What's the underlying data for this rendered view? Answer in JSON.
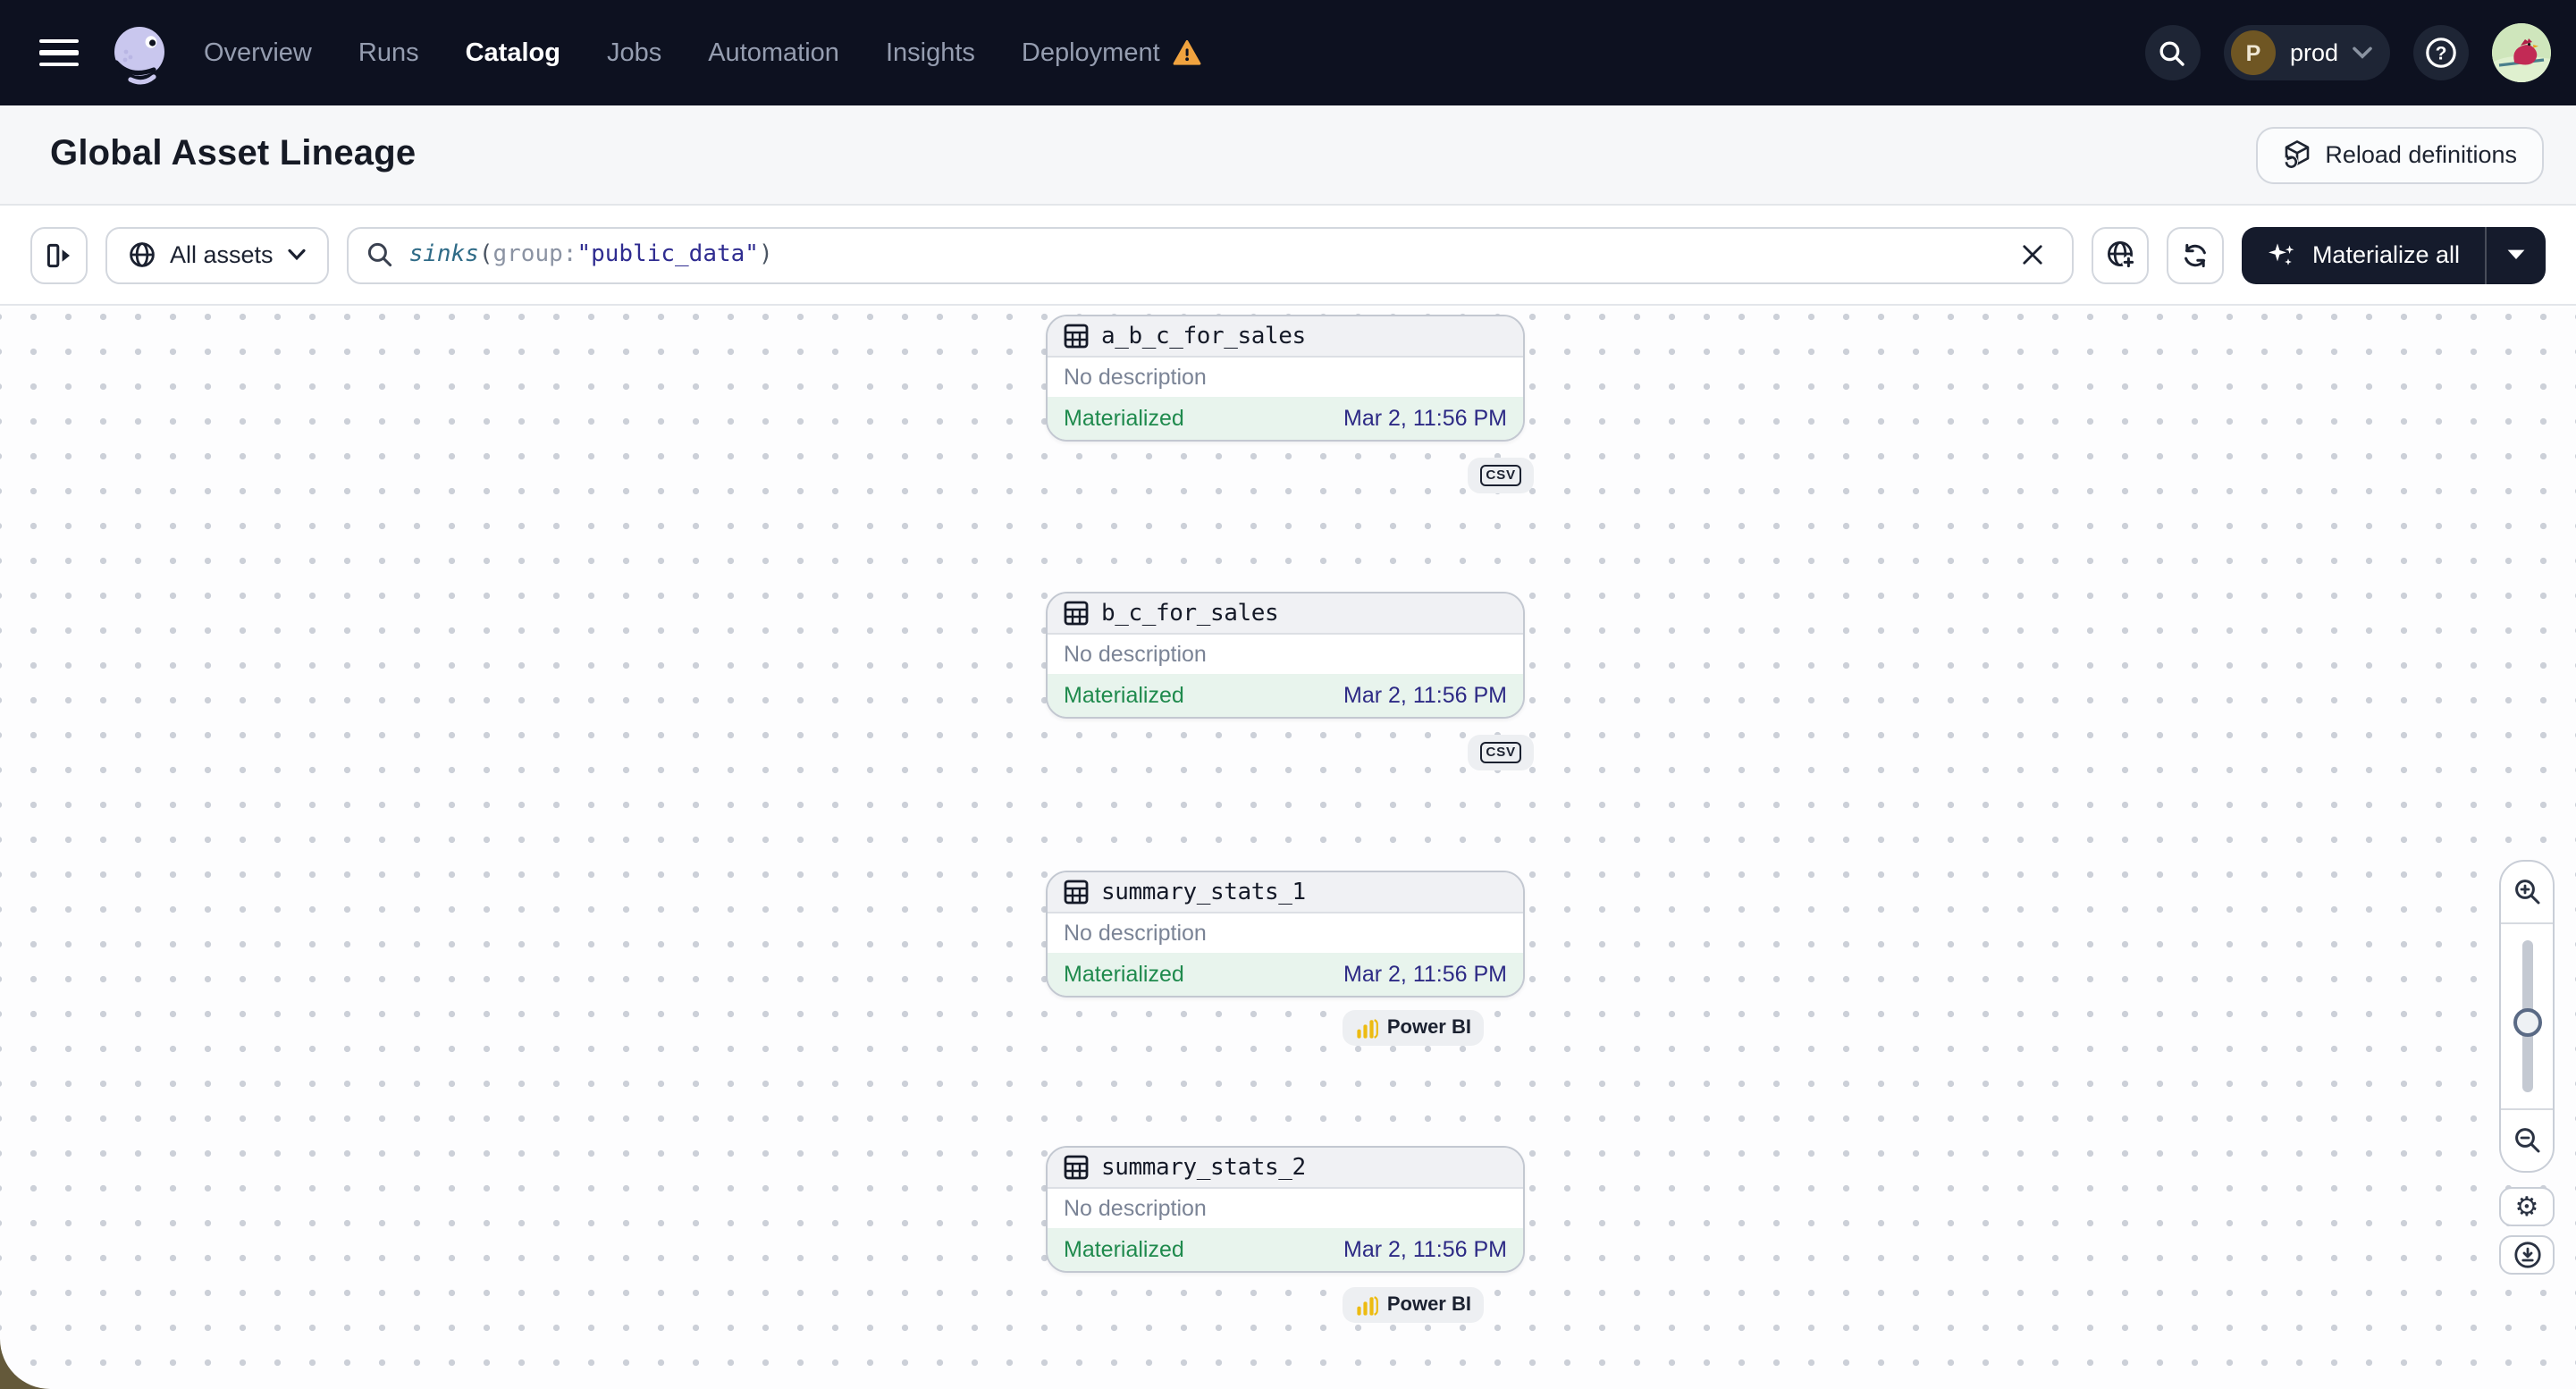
{
  "nav": {
    "items": [
      {
        "label": "Overview",
        "active": false
      },
      {
        "label": "Runs",
        "active": false
      },
      {
        "label": "Catalog",
        "active": true
      },
      {
        "label": "Jobs",
        "active": false
      },
      {
        "label": "Automation",
        "active": false
      },
      {
        "label": "Insights",
        "active": false
      },
      {
        "label": "Deployment",
        "active": false,
        "warning": true
      }
    ],
    "environment": {
      "initial": "P",
      "name": "prod"
    }
  },
  "header": {
    "title": "Global Asset Lineage",
    "reload_label": "Reload definitions"
  },
  "toolbar": {
    "filter_label": "All assets",
    "query": {
      "fn": "sinks",
      "open_paren": "(",
      "attr": "group",
      "colon": ":",
      "value": "\"public_data\"",
      "close_paren": ")"
    },
    "materialize_label": "Materialize all"
  },
  "canvas": {
    "nodes": [
      {
        "name": "a_b_c_for_sales",
        "description": "No description",
        "status": "Materialized",
        "timestamp": "Mar 2, 11:56 PM",
        "tag": "CSV"
      },
      {
        "name": "b_c_for_sales",
        "description": "No description",
        "status": "Materialized",
        "timestamp": "Mar 2, 11:56 PM",
        "tag": "CSV"
      },
      {
        "name": "summary_stats_1",
        "description": "No description",
        "status": "Materialized",
        "timestamp": "Mar 2, 11:56 PM",
        "tag": "Power BI"
      },
      {
        "name": "summary_stats_2",
        "description": "No description",
        "status": "Materialized",
        "timestamp": "Mar 2, 11:56 PM",
        "tag": "Power BI"
      }
    ]
  },
  "icons": {
    "hamburger": "menu",
    "dagster-logo": "octopus mascot",
    "deployment-warning": "warning triangle",
    "search": "magnifier",
    "help": "question mark circle",
    "panel-toggle": "expand left panel",
    "filter-globe": "globe",
    "clear": "x",
    "new-tab-globe": "globe plus",
    "refresh": "circular arrows",
    "materialize-sparkle": "sparkles",
    "caret-down": "triangle down",
    "reload": "cube refresh",
    "table": "table grid",
    "csv": "CSV file",
    "power-bi": "yellow bar chart",
    "zoom-in": "magnifier plus",
    "zoom-out": "magnifier minus",
    "settings": "gear",
    "download": "arrow down circle"
  },
  "colors": {
    "nav_bg": "#0d1120",
    "accent_lavender": "#c9c7ee",
    "warning": "#f0a33f",
    "materialized_green": "#1f8a4d",
    "materialized_bg": "#e8f4ed",
    "timestamp_indigo": "#2d2a85",
    "query_fn_teal": "#2f6b87",
    "query_value_indigo": "#2f2c90",
    "powerbi_yellow": "#edbb11",
    "corner_olive": "#64593a"
  }
}
